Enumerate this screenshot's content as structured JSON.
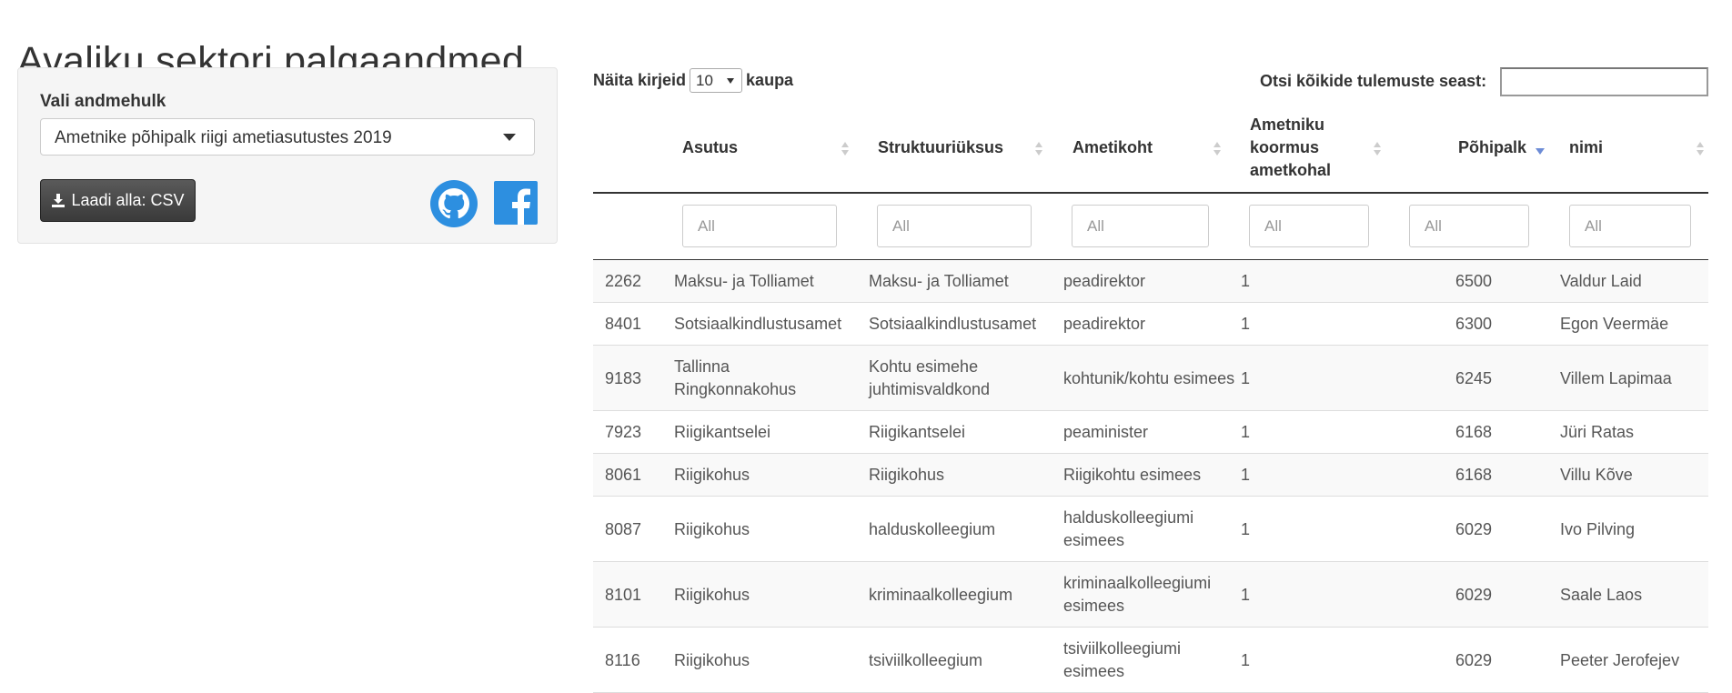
{
  "page": {
    "title": "Avaliku sektori palgaandmed"
  },
  "sidebar": {
    "dataset_label": "Vali andmehulk",
    "dataset_selected": "Ametnike põhipalk riigi ametiasutustes 2019",
    "download_label": "Laadi alla: CSV",
    "github_icon": "github-icon",
    "facebook_icon": "facebook-icon",
    "colors": {
      "github": "#2d8fe0",
      "facebook": "#2d8fe0",
      "button": "#3f3f3f"
    }
  },
  "controls": {
    "length_prefix": "Näita kirjeid",
    "length_value": "10",
    "length_suffix": "kaupa",
    "search_label": "Otsi kõikide tulemuste seast:",
    "search_value": ""
  },
  "table": {
    "columns": [
      {
        "label": "",
        "sortable": false
      },
      {
        "label": "Asutus",
        "sortable": true
      },
      {
        "label": "Struktuuriüksus",
        "sortable": true
      },
      {
        "label": "Ametikoht",
        "sortable": true
      },
      {
        "label": "Ametniku koormus ametkohal",
        "sortable": true
      },
      {
        "label": "Põhipalk",
        "sortable": true,
        "sorted": "desc"
      },
      {
        "label": "nimi",
        "sortable": true
      }
    ],
    "filter_placeholder": "All",
    "rows": [
      {
        "id": "2262",
        "asutus": "Maksu- ja Tolliamet",
        "struktuur": "Maksu- ja Tolliamet",
        "ametikoht": "peadirektor",
        "koormus": "1",
        "pohipalk": "6500",
        "nimi": "Valdur Laid"
      },
      {
        "id": "8401",
        "asutus": "Sotsiaalkindlustusamet",
        "struktuur": "Sotsiaalkindlustusamet",
        "ametikoht": "peadirektor",
        "koormus": "1",
        "pohipalk": "6300",
        "nimi": "Egon Veermäe"
      },
      {
        "id": "9183",
        "asutus": "Tallinna Ringkonnakohus",
        "struktuur": "Kohtu esimehe juhtimisvaldkond",
        "ametikoht": "kohtunik/kohtu esimees",
        "koormus": "1",
        "pohipalk": "6245",
        "nimi": "Villem Lapimaa"
      },
      {
        "id": "7923",
        "asutus": "Riigikantselei",
        "struktuur": "Riigikantselei",
        "ametikoht": "peaminister",
        "koormus": "1",
        "pohipalk": "6168",
        "nimi": "Jüri Ratas"
      },
      {
        "id": "8061",
        "asutus": "Riigikohus",
        "struktuur": "Riigikohus",
        "ametikoht": "Riigikohtu esimees",
        "koormus": "1",
        "pohipalk": "6168",
        "nimi": "Villu Kõve"
      },
      {
        "id": "8087",
        "asutus": "Riigikohus",
        "struktuur": "halduskolleegium",
        "ametikoht": "halduskolleegiumi esimees",
        "koormus": "1",
        "pohipalk": "6029",
        "nimi": "Ivo Pilving"
      },
      {
        "id": "8101",
        "asutus": "Riigikohus",
        "struktuur": "kriminaalkolleegium",
        "ametikoht": "kriminaalkolleegiumi esimees",
        "koormus": "1",
        "pohipalk": "6029",
        "nimi": "Saale Laos"
      },
      {
        "id": "8116",
        "asutus": "Riigikohus",
        "struktuur": "tsiviilkolleegium",
        "ametikoht": "tsiviilkolleegiumi esimees",
        "koormus": "1",
        "pohipalk": "6029",
        "nimi": "Peeter Jerofejev"
      }
    ]
  }
}
